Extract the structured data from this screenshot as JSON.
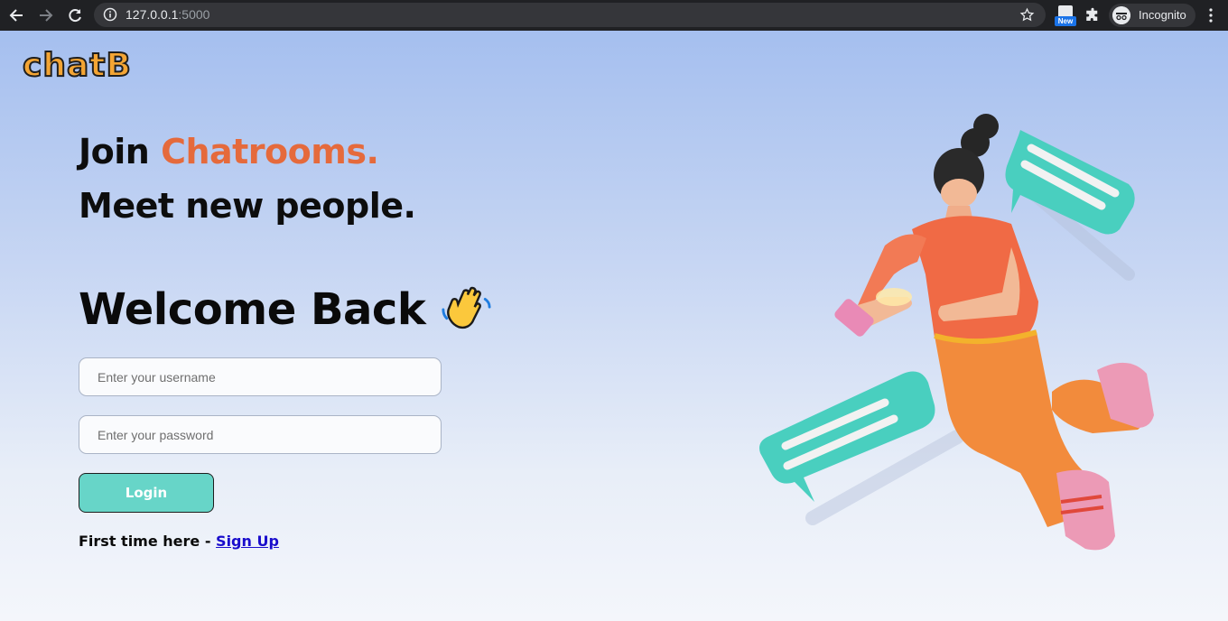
{
  "browser": {
    "url_host": "127.0.0.1",
    "url_port": ":5000",
    "extension_badge": "New",
    "profile_label": "Incognito"
  },
  "page": {
    "logo": "chatB",
    "headline_prefix": "Join ",
    "headline_accent": "Chatrooms.",
    "headline_line2": "Meet new people.",
    "welcome": "Welcome Back",
    "username_placeholder": "Enter your username",
    "password_placeholder": "Enter your password",
    "login_label": "Login",
    "signup_prompt": "First time here - ",
    "signup_link": "Sign Up"
  },
  "colors": {
    "accent": "#e56a3c",
    "button": "#67d5c8",
    "logo": "#f4a534"
  },
  "icons": [
    "back-arrow-icon",
    "forward-arrow-icon",
    "reload-icon",
    "info-icon",
    "star-icon",
    "extension-icon",
    "puzzle-icon",
    "incognito-icon",
    "kebab-menu-icon",
    "waving-hand-icon"
  ]
}
